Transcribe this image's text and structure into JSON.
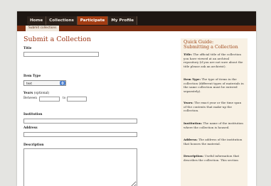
{
  "nav": {
    "items": [
      {
        "label": "Home",
        "active": false
      },
      {
        "label": "Collections",
        "active": false
      },
      {
        "label": "Participate",
        "active": true
      },
      {
        "label": "My Profile",
        "active": false
      }
    ],
    "subitem": "Submit collections",
    "accent_color": "#a23c12"
  },
  "form": {
    "title": "Submit a Collection",
    "title_label": "Title",
    "title_value": "",
    "item_type_label": "Item Type",
    "item_type_selected": "text",
    "years_label": "Years",
    "years_optional": "(optional)",
    "between_label": "Between",
    "to_label": "to",
    "year_start": "",
    "year_end": "",
    "institution_label": "Institution",
    "institution_value": "",
    "address_label": "Address",
    "address_value": "",
    "description_label": "Description",
    "description_value": ""
  },
  "guide": {
    "title_line1": "Quick Guide:",
    "title_line2": "Submitting a Collection",
    "entries": [
      {
        "term": "Title:",
        "text": "The official title of the collection you have viewed at an archival repository (if you are not sure about the title please ask an archivist)."
      },
      {
        "term": "Item Type:",
        "text": "The type of items in the collection (different types of materials in the same collection must be entered separately)."
      },
      {
        "term": "Years:",
        "text": "The exact year or the time span of the contents that make-up the collection."
      },
      {
        "term": "Institution:",
        "text": "The name of the institution where the collection is housed."
      },
      {
        "term": "Address:",
        "text": "The address of the institution that houses the material."
      },
      {
        "term": "Description:",
        "text": "Useful information that describes the collection. This section"
      }
    ]
  }
}
